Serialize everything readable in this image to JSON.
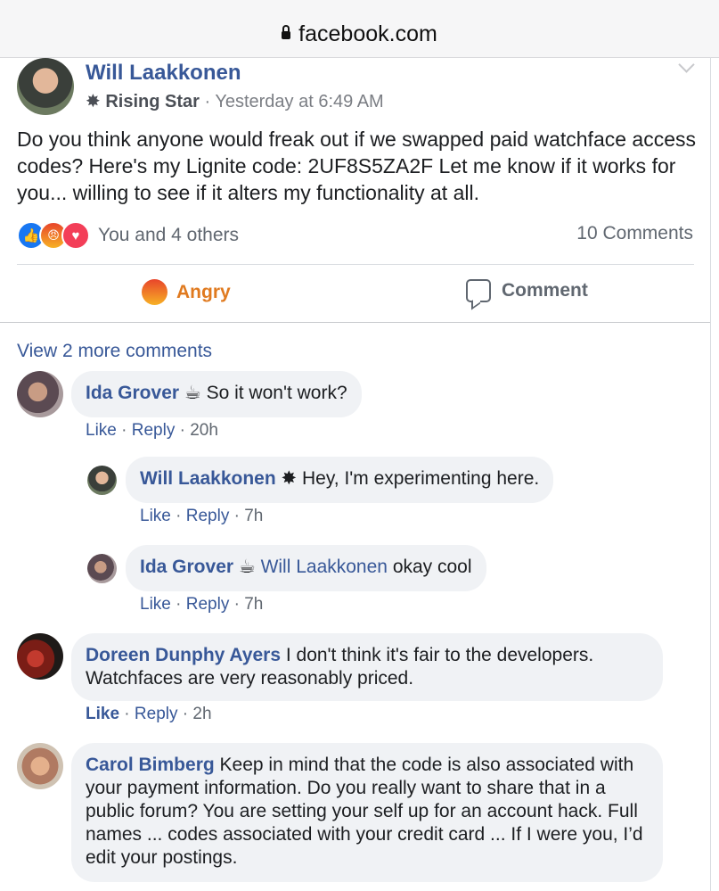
{
  "browser": {
    "url": "facebook.com"
  },
  "post": {
    "author": "Will Laakkonen",
    "badge": "Rising Star",
    "timestamp": "Yesterday at 6:49 AM",
    "text": "Do you think anyone would freak out if we swapped paid watchface access codes? Here's my Lignite code: 2UF8S5ZA2F Let me know if it works for you... willing to see if it alters my functionality at all.",
    "reactions_text": "You and 4 others",
    "comments_count": "10 Comments",
    "actions": {
      "reaction": "Angry",
      "comment": "Comment"
    }
  },
  "comments": {
    "view_more": "View 2 more comments",
    "like": "Like",
    "reply": "Reply",
    "items": [
      {
        "author": "Ida Grover",
        "text": "So it won't work?",
        "time": "20h"
      },
      {
        "author": "Will Laakkonen",
        "text": "Hey, I'm experimenting here.",
        "time": "7h"
      },
      {
        "author": "Ida Grover",
        "mention": "Will Laakkonen",
        "text": "okay cool",
        "time": "7h"
      },
      {
        "author": "Doreen Dunphy Ayers",
        "text": "I don't think it's fair to the developers. Watchfaces are very reasonably priced.",
        "time": "2h"
      },
      {
        "author": "Carol Bimberg",
        "text": "Keep in mind that the code is also associated with your payment information. Do you really want to share that in a public forum? You are setting your self up for an account hack. Full names ... codes associated with your credit card ... If I were you, I’d edit your postings."
      }
    ]
  }
}
